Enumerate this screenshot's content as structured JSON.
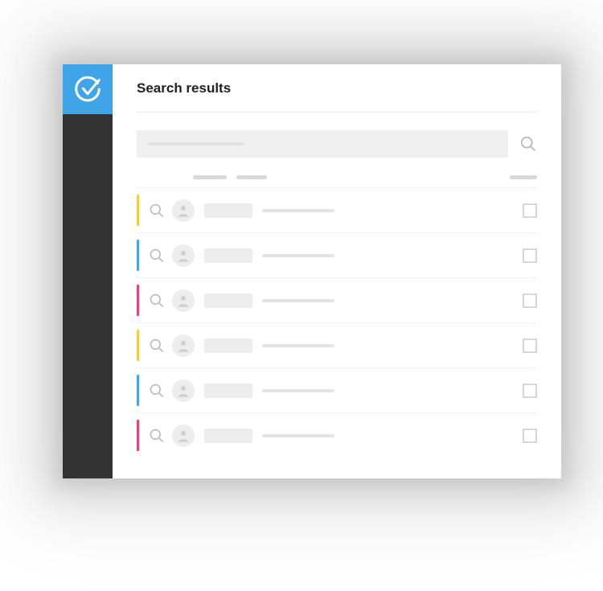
{
  "header": {
    "title": "Search results"
  },
  "search": {
    "value": "",
    "placeholder": ""
  },
  "colors": {
    "sidebar": "#333333",
    "logo_bg": "#3fa4e8",
    "accent_yellow": "#f7c948",
    "accent_blue": "#3fa4e8",
    "accent_pink": "#e8407a"
  },
  "columns": {
    "col1": "",
    "col2": "",
    "col3": ""
  },
  "results": [
    {
      "accent": "#f7c948",
      "name": "",
      "detail": "",
      "checked": false
    },
    {
      "accent": "#3fa4e8",
      "name": "",
      "detail": "",
      "checked": false
    },
    {
      "accent": "#e8407a",
      "name": "",
      "detail": "",
      "checked": false
    },
    {
      "accent": "#f7c948",
      "name": "",
      "detail": "",
      "checked": false
    },
    {
      "accent": "#3fa4e8",
      "name": "",
      "detail": "",
      "checked": false
    },
    {
      "accent": "#e8407a",
      "name": "",
      "detail": "",
      "checked": false
    }
  ]
}
